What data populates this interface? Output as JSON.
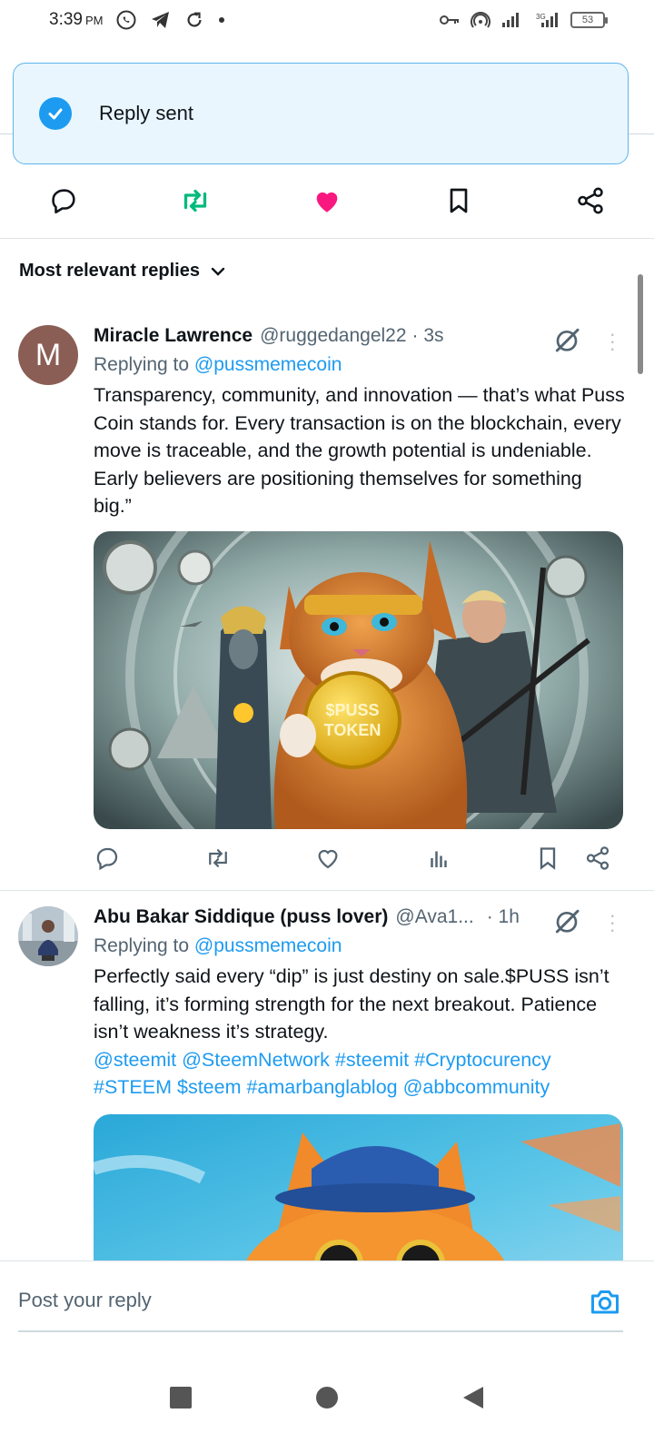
{
  "status_bar": {
    "time": "3:39",
    "ampm": "PM",
    "left_icons": [
      "whatsapp-icon",
      "telegram-icon",
      "refresh-icon",
      "dot-icon"
    ],
    "right_icons": [
      "key-icon",
      "hotspot-icon",
      "signal-icon",
      "signal-3g-icon"
    ],
    "battery": "53"
  },
  "toast": {
    "text": "Reply sent",
    "icon": "check-circle-icon",
    "color": "#1d9bf0"
  },
  "main_actions": [
    "reply-icon",
    "retweet-icon",
    "like-icon",
    "bookmark-icon",
    "share-icon"
  ],
  "sort": {
    "label": "Most relevant replies"
  },
  "replies": [
    {
      "avatar_letter": "M",
      "name": "Miracle Lawrence",
      "handle": "@ruggedangel22",
      "time": "· 3s",
      "reply_prefix": "Replying to ",
      "reply_to": "@pussmemecoin",
      "text": "Transparency, community, and innovation — that’s what Puss Coin stands for. Every transaction is on the blockchain, every move is traceable, and the growth potential is undeniable. Early believers are positioning themselves for something big.”",
      "coin_text": "$PUSS TOKEN"
    },
    {
      "name": "Abu Bakar Siddique (puss lover)",
      "handle": "@Ava1...",
      "time": "· 1h",
      "reply_prefix": "Replying to ",
      "reply_to": "@pussmemecoin",
      "text": "Perfectly said every “dip” is just destiny on sale.$PUSS isn’t falling, it’s forming strength for the next breakout. Patience isn’t weakness  it’s strategy.",
      "tags": "@steemit @SteemNetwork #steemit #Cryptocurency #STEEM $steem #amarbanglablog @abbcommunity"
    }
  ],
  "compose": {
    "placeholder": "Post your reply"
  },
  "colors": {
    "accent": "#1d9bf0",
    "retweet": "#00ba7c",
    "like": "#f91880"
  }
}
